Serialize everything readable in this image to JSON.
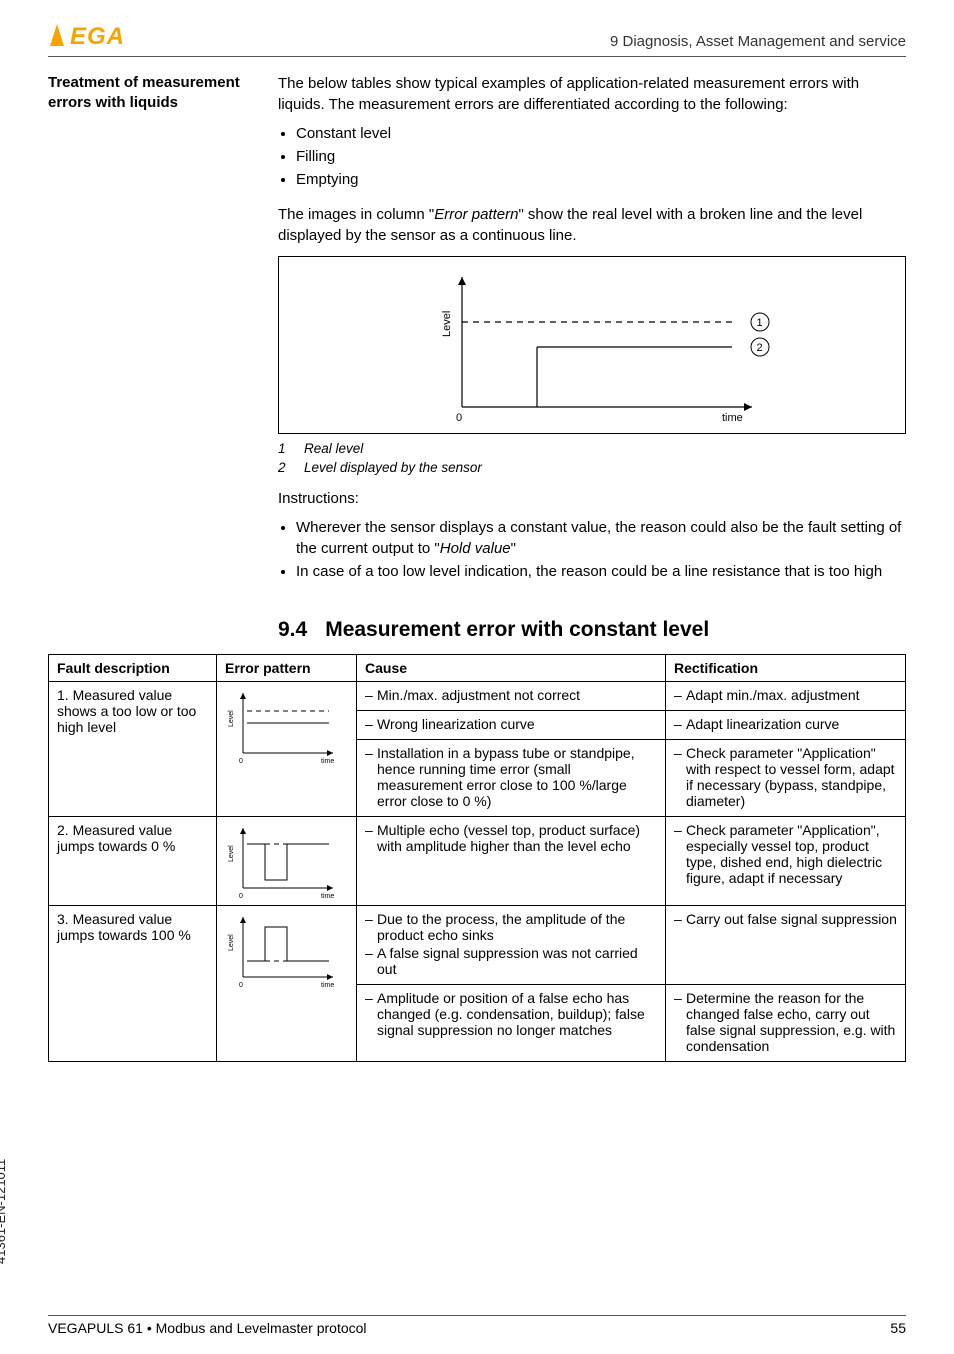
{
  "header": {
    "section_title": "9 Diagnosis, Asset Management and service"
  },
  "aside": {
    "treatment_heading": "Treatment of measurement errors with liquids"
  },
  "body": {
    "intro": "The below tables show typical examples of application-related measurement errors with liquids. The measurement errors are differentiated according to the following:",
    "bullets": [
      "Constant level",
      "Filling",
      "Emptying"
    ],
    "images_note_pre": "The images in column \"",
    "images_note_em": "Error pattern",
    "images_note_post": "\" show the real level with a broken line and the level displayed by the sensor as a continuous line.",
    "figure": {
      "y_label": "Level",
      "x_label": "time",
      "origin": "0",
      "marker1": "1",
      "marker2": "2"
    },
    "caption": {
      "row1_num": "1",
      "row1_text": "Real level",
      "row2_num": "2",
      "row2_text": "Level displayed by the sensor"
    },
    "instructions_label": "Instructions:",
    "instr1_pre": "Wherever the sensor displays a constant value, the reason could also be the fault setting of the current output to \"",
    "instr1_em": "Hold value",
    "instr1_post": "\"",
    "instr2": "In case of a too low level indication, the reason could be a line resistance that is too high"
  },
  "section": {
    "num": "9.4",
    "title": "Measurement error with constant level"
  },
  "table": {
    "headers": {
      "fd": "Fault description",
      "ep": "Error pattern",
      "cause": "Cause",
      "rect": "Rectification"
    },
    "row1": {
      "fd": "1. Measured value shows a too low or too high level",
      "c1": "Min./max. adjustment not correct",
      "r1": "Adapt min./max. adjustment",
      "c2": "Wrong linearization curve",
      "r2": "Adapt linearization curve",
      "c3": "Installation in a bypass tube or standpipe, hence running time error (small measurement error close to 100 %/large error close to 0 %)",
      "r3": "Check parameter \"Application\" with respect to vessel form, adapt if necessary (bypass, standpipe, diameter)"
    },
    "row2": {
      "fd": "2. Measured value jumps towards 0 %",
      "c1": "Multiple echo (vessel top, product surface) with amplitude higher than the level echo",
      "r1": "Check parameter \"Application\", especially vessel top, product type, dished end, high dielectric figure, adapt if necessary"
    },
    "row3": {
      "fd": "3. Measured value jumps towards 100 %",
      "c1": "Due to the process, the amplitude of the product echo sinks",
      "c1b": "A false signal suppression was not carried out",
      "r1": "Carry out false signal suppression",
      "c2": "Amplitude or position of a false echo has changed (e.g. condensation, buildup); false signal suppression no longer matches",
      "r2": "Determine the reason for the changed false echo, carry out false signal suppression, e.g. with condensation"
    },
    "ep_axis_y": "Level",
    "ep_axis_x": "time"
  },
  "footer": {
    "left": "VEGAPULS 61 • Modbus and Levelmaster protocol",
    "right": "55"
  },
  "side_code": "41361-EN-121011"
}
